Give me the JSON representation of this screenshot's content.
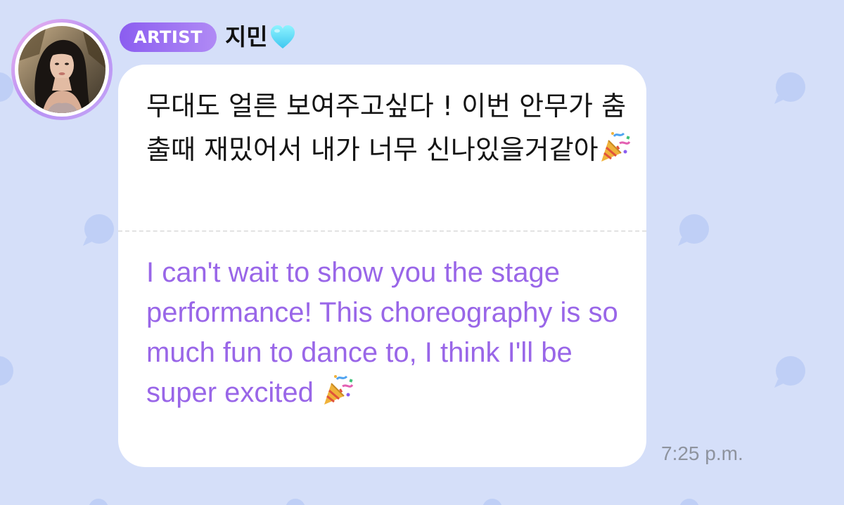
{
  "colors": {
    "background": "#d5dff9",
    "pattern_bubble": "#bfcff6",
    "badge_gradient_start": "#8b5df0",
    "badge_gradient_end": "#b08af5",
    "translation_text": "#9966e8",
    "timestamp_text": "#8e939e"
  },
  "sender": {
    "badge_label": "ARTIST",
    "name": "지민",
    "name_icon": "light-blue-heart-icon",
    "avatar_icon": "profile-photo"
  },
  "message": {
    "original_text": "무대도 얼른 보여주고싶다 ! 이번 안무가 춤출때 재밌어서 내가 너무 신나있을거같아",
    "original_emoji": "party-popper-icon",
    "translation_text": "I can't wait to show you the stage performance! This choreography is so much fun to dance to, I think I'll be super excited",
    "translation_emoji": "party-popper-icon",
    "timestamp": "7:25 p.m."
  }
}
